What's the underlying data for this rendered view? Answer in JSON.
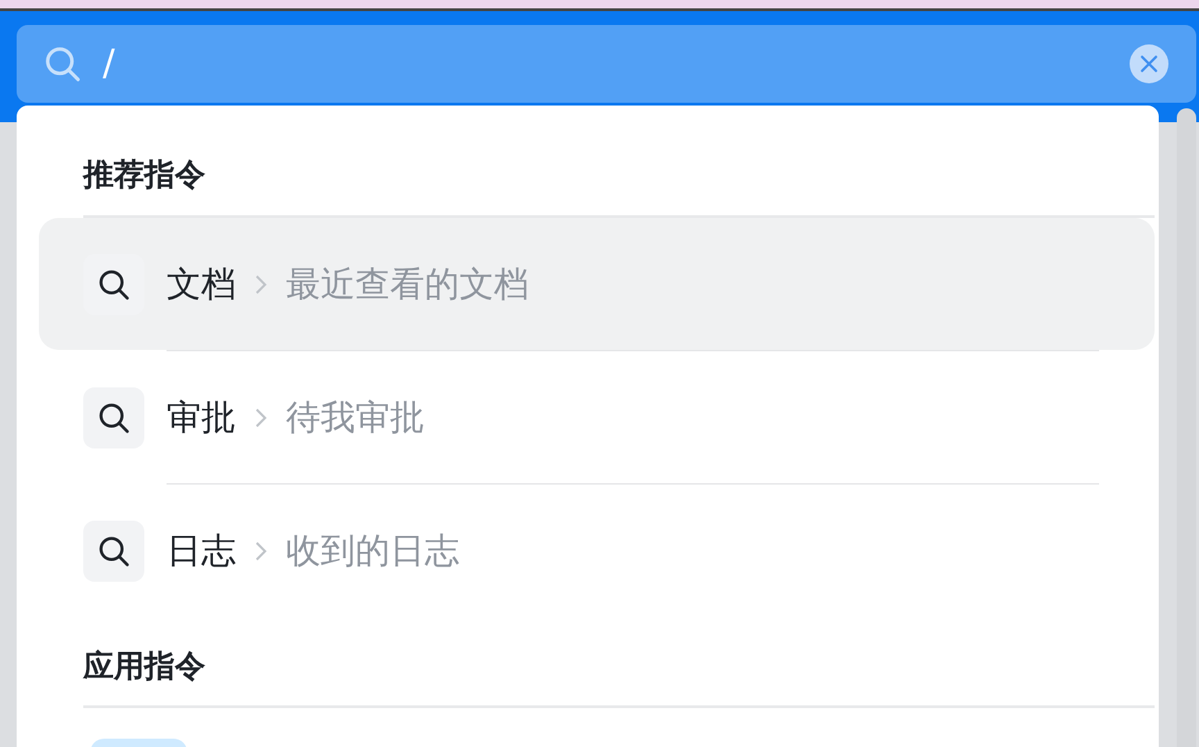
{
  "search": {
    "value": "/"
  },
  "sections": [
    {
      "title": "推荐指令",
      "items": [
        {
          "name": "文档",
          "target": "最近查看的文档",
          "selected": true
        },
        {
          "name": "审批",
          "target": "待我审批",
          "selected": false
        },
        {
          "name": "日志",
          "target": "收到的日志",
          "selected": false
        }
      ]
    },
    {
      "title": "应用指令"
    }
  ]
}
